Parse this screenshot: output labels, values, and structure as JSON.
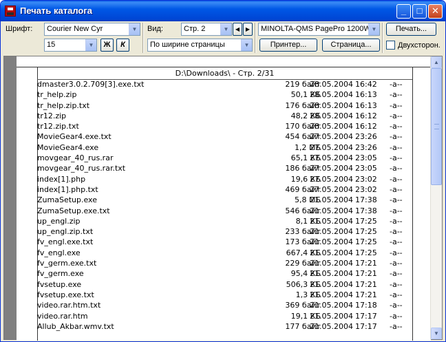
{
  "window": {
    "title": "Печать каталога",
    "minimize": "_",
    "maximize": "□",
    "close": "✕"
  },
  "toolbar": {
    "font_label": "Шрифт:",
    "font_value": "Courier New Cyr",
    "size_value": "15",
    "bold_label": "Ж",
    "italic_label": "К",
    "view_label": "Вид:",
    "page_value": "Стр. 2",
    "prev_page": "◀",
    "next_page": "▶",
    "fit_value": "По ширине страницы",
    "printer_value": "MINOLTA-QMS PagePro 1200W",
    "printer_button": "Принтер...",
    "page_button": "Страница...",
    "print_button": "Печать...",
    "duplex_label": "Двухсторон."
  },
  "page": {
    "header": "D:\\Downloads\\ - Стр. 2/31",
    "files": [
      {
        "name": "dmaster3.0.2.709[3].exe.txt",
        "size": "219 байт",
        "date": "28.05.2004",
        "time": "16:42",
        "attr": "-a--"
      },
      {
        "name": "tr_help.zip",
        "size": "50,1 КБ",
        "date": "28.05.2004",
        "time": "16:13",
        "attr": "-a--"
      },
      {
        "name": "tr_help.zip.txt",
        "size": "176 байт",
        "date": "28.05.2004",
        "time": "16:13",
        "attr": "-a--"
      },
      {
        "name": "tr12.zip",
        "size": "48,2 КБ",
        "date": "28.05.2004",
        "time": "16:12",
        "attr": "-a--"
      },
      {
        "name": "tr12.zip.txt",
        "size": "170 байт",
        "date": "28.05.2004",
        "time": "16:12",
        "attr": "-a--"
      },
      {
        "name": "MovieGear4.exe.txt",
        "size": "454 байт",
        "date": "27.05.2004",
        "time": "23:26",
        "attr": "-a--"
      },
      {
        "name": "MovieGear4.exe",
        "size": "1,2 МБ",
        "date": "27.05.2004",
        "time": "23:26",
        "attr": "-a--"
      },
      {
        "name": "movgear_40_rus.rar",
        "size": "65,1 КБ",
        "date": "27.05.2004",
        "time": "23:05",
        "attr": "-a--"
      },
      {
        "name": "movgear_40_rus.rar.txt",
        "size": "186 байт",
        "date": "27.05.2004",
        "time": "23:05",
        "attr": "-a--"
      },
      {
        "name": "index[1].php",
        "size": "19,6 КБ",
        "date": "27.05.2004",
        "time": "23:02",
        "attr": "-a--"
      },
      {
        "name": "index[1].php.txt",
        "size": "469 байт",
        "date": "27.05.2004",
        "time": "23:02",
        "attr": "-a--"
      },
      {
        "name": "ZumaSetup.exe",
        "size": "5,8 МБ",
        "date": "21.05.2004",
        "time": "17:38",
        "attr": "-a--"
      },
      {
        "name": "ZumaSetup.exe.txt",
        "size": "546 байт",
        "date": "21.05.2004",
        "time": "17:38",
        "attr": "-a--"
      },
      {
        "name": "up_engl.zip",
        "size": "8,1 КБ",
        "date": "21.05.2004",
        "time": "17:25",
        "attr": "-a--"
      },
      {
        "name": "up_engl.zip.txt",
        "size": "233 байт",
        "date": "21.05.2004",
        "time": "17:25",
        "attr": "-a--"
      },
      {
        "name": "fv_engl.exe.txt",
        "size": "173 байт",
        "date": "21.05.2004",
        "time": "17:25",
        "attr": "-a--"
      },
      {
        "name": "fv_engl.exe",
        "size": "667,4 КБ",
        "date": "21.05.2004",
        "time": "17:25",
        "attr": "-a--"
      },
      {
        "name": "fv_germ.exe.txt",
        "size": "229 байт",
        "date": "21.05.2004",
        "time": "17:21",
        "attr": "-a--"
      },
      {
        "name": "fv_germ.exe",
        "size": "95,4 КБ",
        "date": "21.05.2004",
        "time": "17:21",
        "attr": "-a--"
      },
      {
        "name": "fvsetup.exe",
        "size": "506,3 КБ",
        "date": "21.05.2004",
        "time": "17:21",
        "attr": "-a--"
      },
      {
        "name": "fvsetup.exe.txt",
        "size": "1,3 КБ",
        "date": "21.05.2004",
        "time": "17:21",
        "attr": "-a--"
      },
      {
        "name": "video.rar.htm.txt",
        "size": "369 байт",
        "date": "21.05.2004",
        "time": "17:18",
        "attr": "-a--"
      },
      {
        "name": "video.rar.htm",
        "size": "19,1 КБ",
        "date": "21.05.2004",
        "time": "17:17",
        "attr": "-a--"
      },
      {
        "name": "Allub_Akbar.wmv.txt",
        "size": "177 байт",
        "date": "21.05.2004",
        "time": "17:17",
        "attr": "-a--"
      }
    ]
  },
  "icons": {
    "dropdown": "▼",
    "scroll_up": "▲",
    "scroll_down": "▼"
  }
}
